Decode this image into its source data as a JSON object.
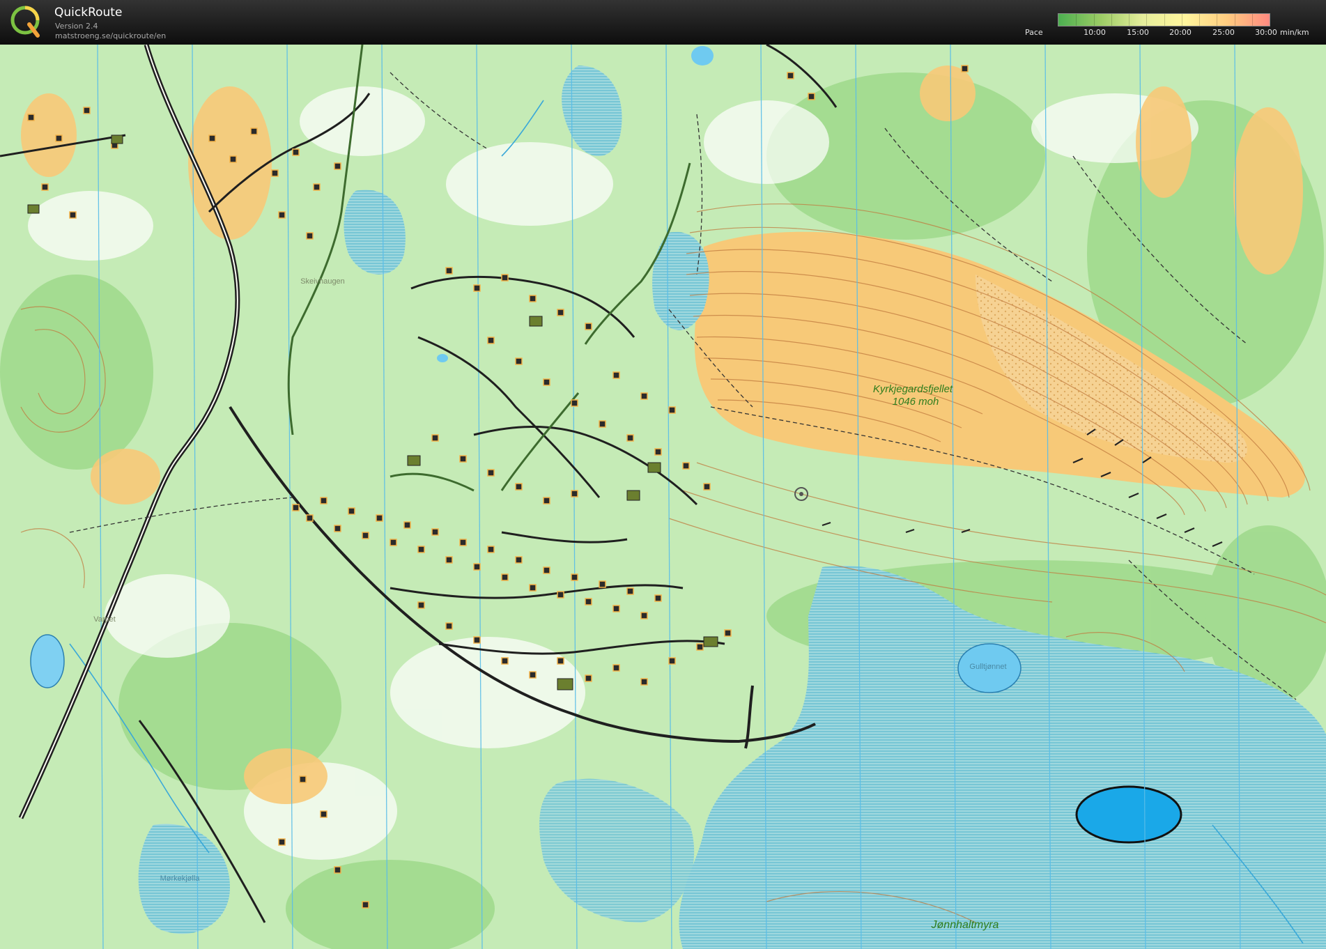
{
  "app": {
    "name": "QuickRoute",
    "version": "Version 2.4",
    "url": "matstroeng.se/quickroute/en",
    "logo_letter": "Q"
  },
  "pace_legend": {
    "label": "Pace",
    "unit": "min/km",
    "ticks": [
      "10:00",
      "15:00",
      "20:00",
      "25:00",
      "30:00"
    ],
    "gradient_colors": [
      "#4caf50",
      "#9ccc65",
      "#e6ee9c",
      "#fff59d",
      "#ffcc80",
      "#ff8a80"
    ]
  },
  "map": {
    "place_names": {
      "mountain": "Kyrkjegardsfjellet",
      "elevation": "1046 moh",
      "marsh": "Jønnhaltmyra",
      "lake_east": "Gulltjønnet",
      "hamlet_north": "Skeivhaugen",
      "hamlet_west": "Varpet",
      "lake_southwest": "Mørkekjølla"
    },
    "colors": {
      "forest": "#b8e6a8",
      "forest_dense": "#8fd37c",
      "open_land": "#f7c674",
      "marsh": "#8bcfd9",
      "water": "#3fb7e8",
      "magnetic_lines": "#5fc0ea",
      "road": "#1f1f1f",
      "building": "#2b2b2b",
      "contour": "#b7733a"
    }
  }
}
